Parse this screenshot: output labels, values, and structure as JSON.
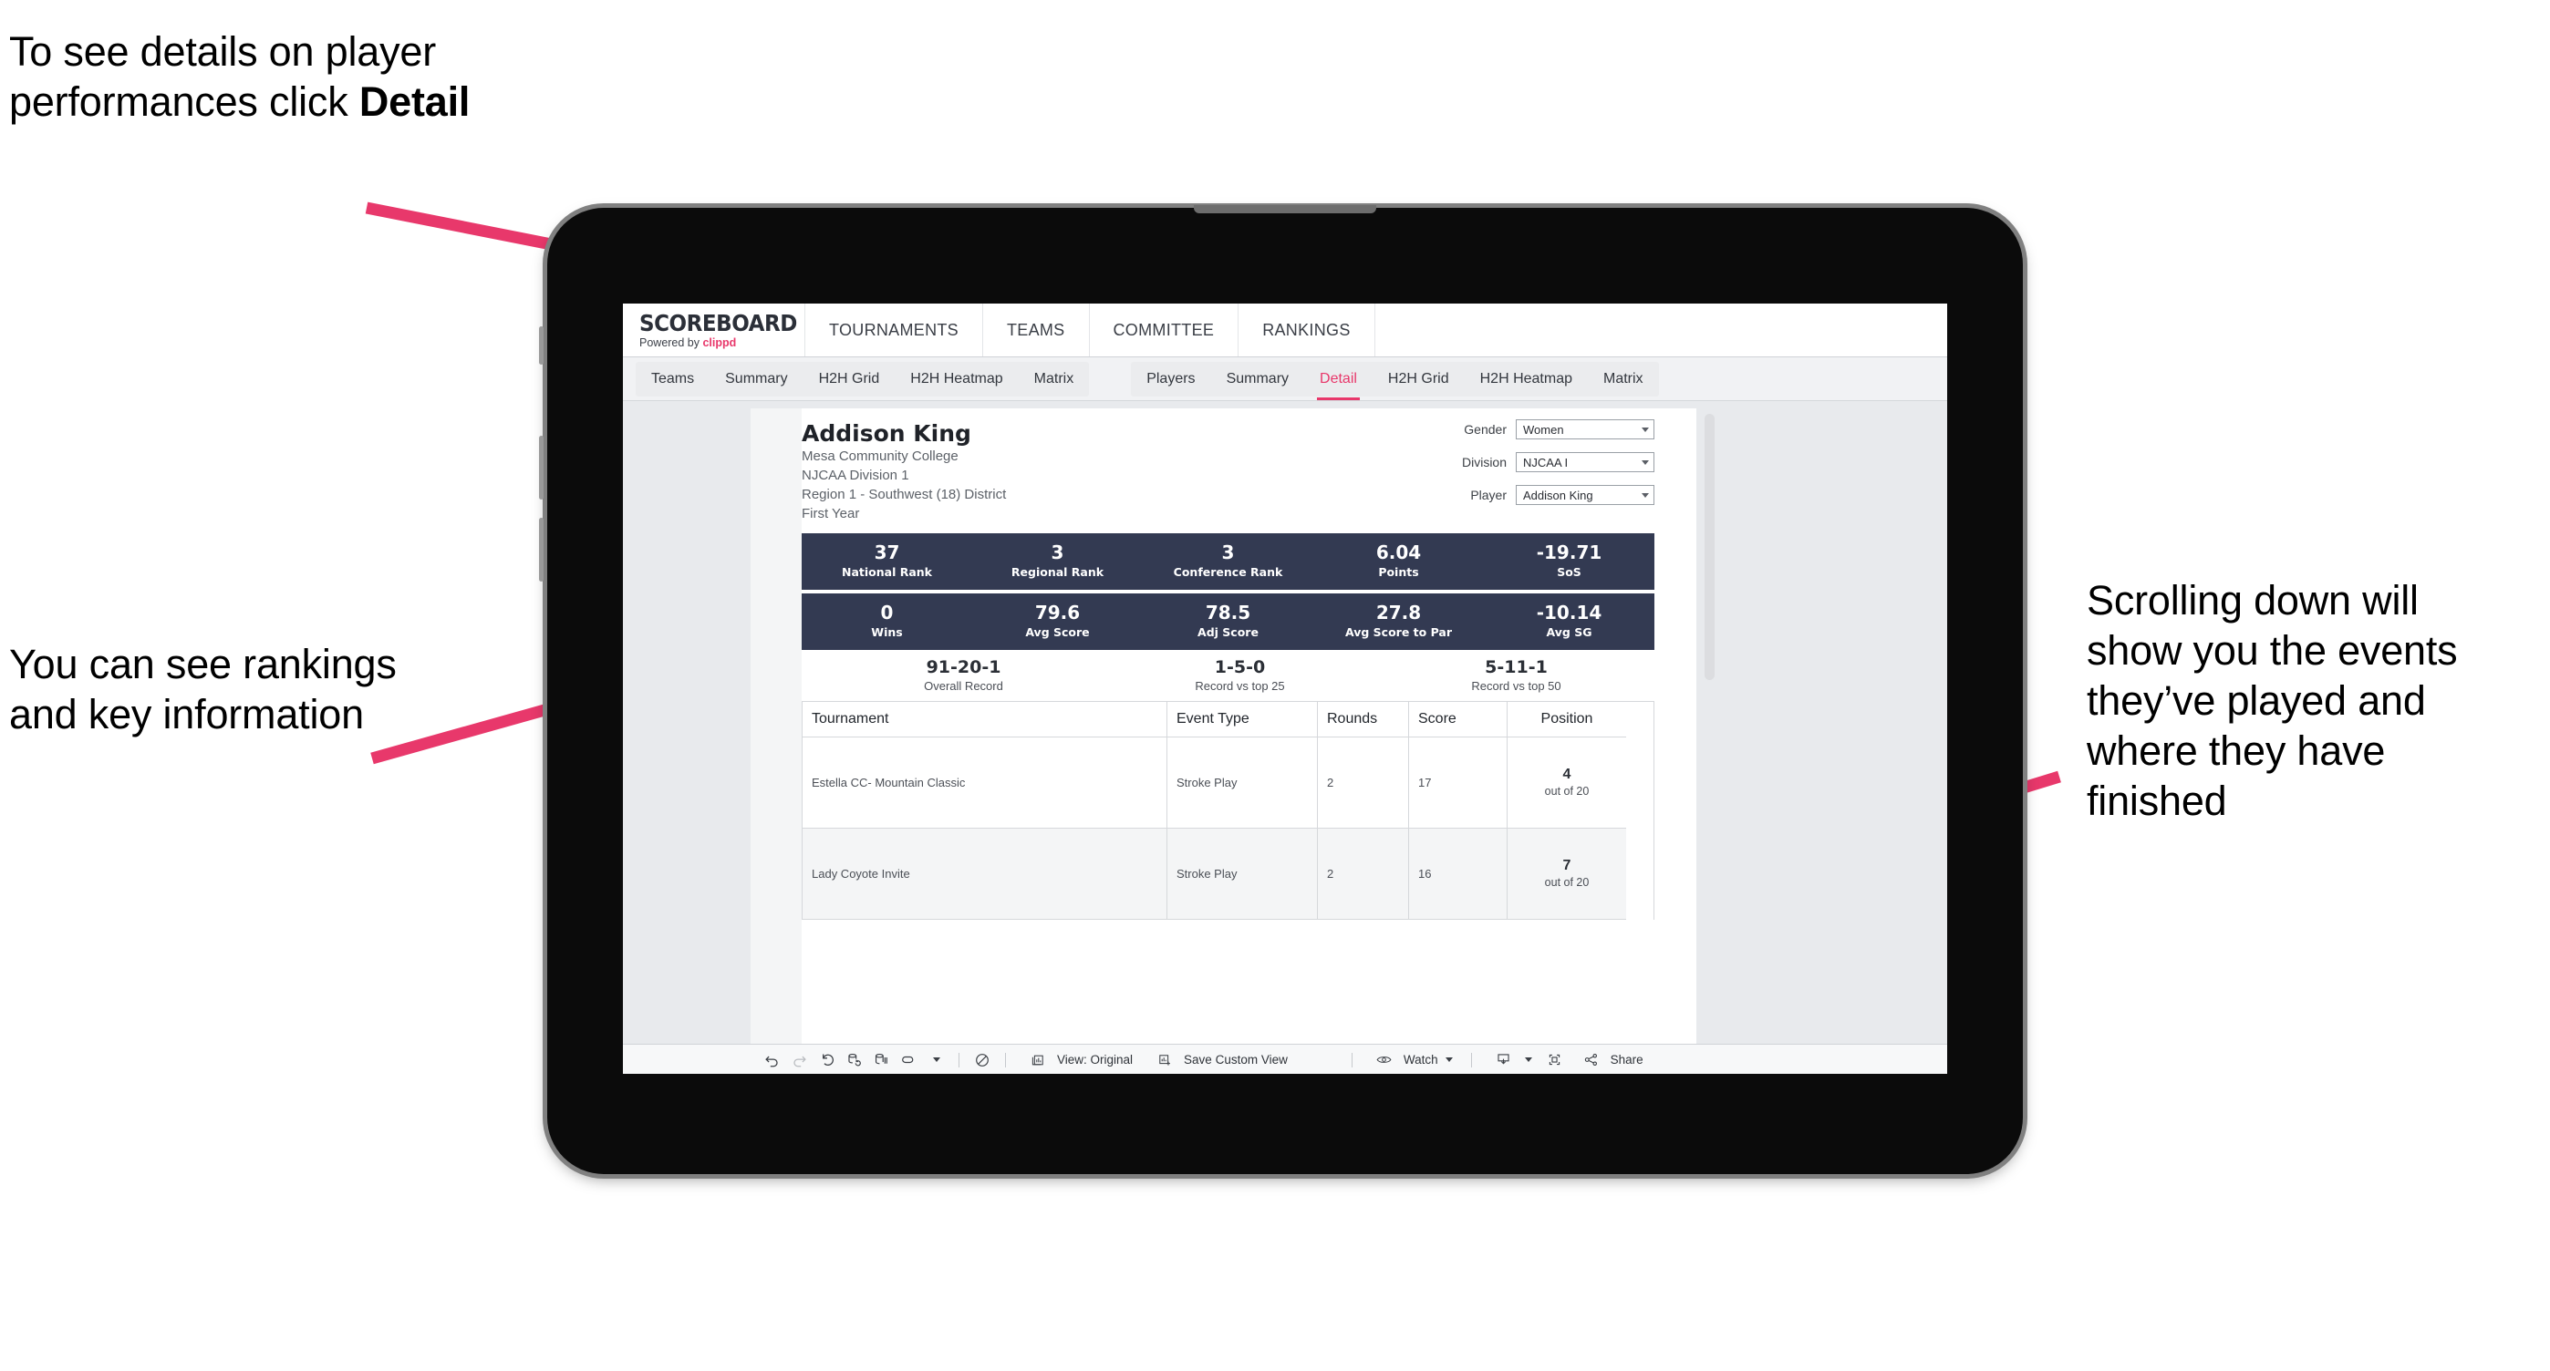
{
  "annotations": {
    "top_left": "To see details on player performances click ",
    "top_left_bold": "Detail",
    "left": "You can see rankings and key information",
    "right": "Scrolling down will show you the events they’ve played and where they have finished"
  },
  "app": {
    "brand": {
      "title": "SCOREBOARD",
      "powered_prefix": "Powered by ",
      "powered_brand": "clippd"
    },
    "top_nav": [
      "TOURNAMENTS",
      "TEAMS",
      "COMMITTEE",
      "RANKINGS"
    ],
    "sub_nav_group_1": [
      "Teams",
      "Summary",
      "H2H Grid",
      "H2H Heatmap",
      "Matrix"
    ],
    "sub_nav_group_2": [
      "Players",
      "Summary",
      "Detail",
      "H2H Grid",
      "H2H Heatmap",
      "Matrix"
    ],
    "sub_nav_active": "Detail"
  },
  "player": {
    "name": "Addison King",
    "school": "Mesa Community College",
    "division": "NJCAA Division 1",
    "region": "Region 1 - Southwest (18) District",
    "year": "First Year"
  },
  "filters": [
    {
      "label": "Gender",
      "value": "Women"
    },
    {
      "label": "Division",
      "value": "NJCAA I"
    },
    {
      "label": "Player",
      "value": "Addison King"
    }
  ],
  "stats_row_1": [
    {
      "value": "37",
      "label": "National Rank"
    },
    {
      "value": "3",
      "label": "Regional Rank"
    },
    {
      "value": "3",
      "label": "Conference Rank"
    },
    {
      "value": "6.04",
      "label": "Points"
    },
    {
      "value": "-19.71",
      "label": "SoS"
    }
  ],
  "stats_row_2": [
    {
      "value": "0",
      "label": "Wins"
    },
    {
      "value": "79.6",
      "label": "Avg Score"
    },
    {
      "value": "78.5",
      "label": "Adj Score"
    },
    {
      "value": "27.8",
      "label": "Avg Score to Par"
    },
    {
      "value": "-10.14",
      "label": "Avg SG"
    }
  ],
  "stats_row_3": [
    {
      "value": "91-20-1",
      "label": "Overall Record"
    },
    {
      "value": "1-5-0",
      "label": "Record vs top 25"
    },
    {
      "value": "5-11-1",
      "label": "Record vs top 50"
    }
  ],
  "table": {
    "columns": [
      "Tournament",
      "Event Type",
      "Rounds",
      "Score",
      "Position"
    ],
    "rows": [
      {
        "tournament": "Estella CC- Mountain Classic",
        "event_type": "Stroke Play",
        "rounds": "2",
        "score": "17",
        "position_value": "4",
        "position_label": "out of 20"
      },
      {
        "tournament": "Lady Coyote Invite",
        "event_type": "Stroke Play",
        "rounds": "2",
        "score": "16",
        "position_value": "7",
        "position_label": "out of 20"
      }
    ]
  },
  "toolbar": {
    "view_label": "View: Original",
    "save_label": "Save Custom View",
    "watch_label": "Watch",
    "share_label": "Share"
  },
  "colors": {
    "accent_pink": "#e8386b",
    "band_navy": "#333a52",
    "arrow_pink": "#e8386b"
  }
}
